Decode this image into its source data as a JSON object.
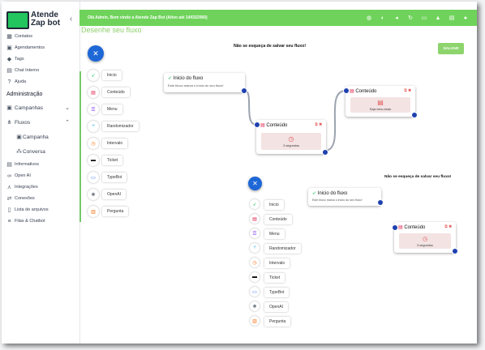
{
  "app": {
    "logo_line1": "Atende",
    "logo_line2": "Zap bot"
  },
  "topbar": {
    "message": "Olá Admin, Bem vindo a Atende Zap Bot (Ativo até 14/03/2060)"
  },
  "page": {
    "title": "Desenhe seu fluxo"
  },
  "sidebar": {
    "items": [
      {
        "label": "Contatos",
        "icon": "contacts-icon"
      },
      {
        "label": "Agendamentos",
        "icon": "calendar-icon"
      },
      {
        "label": "Tags",
        "icon": "tag-icon"
      },
      {
        "label": "Chat Interno",
        "icon": "chat-icon"
      },
      {
        "label": "Ajuda",
        "icon": "help-icon"
      }
    ],
    "section": "Administração",
    "groups": [
      {
        "label": "Campanhas",
        "icon": "campaign-icon"
      },
      {
        "label": "Fluxos",
        "icon": "flow-icon"
      }
    ],
    "sub_items": [
      {
        "label": "Campanha",
        "icon": "calendar-icon"
      },
      {
        "label": "Conversa",
        "icon": "conversation-icon"
      }
    ],
    "items2": [
      {
        "label": "Informativos",
        "icon": "info-icon"
      },
      {
        "label": "Open AI",
        "icon": "openai-icon"
      },
      {
        "label": "Integrações",
        "icon": "integration-icon"
      },
      {
        "label": "Conexões",
        "icon": "connection-icon"
      },
      {
        "label": "Lista de arquivos",
        "icon": "file-icon"
      },
      {
        "label": "Filas & Chatbot",
        "icon": "queue-icon"
      }
    ]
  },
  "canvas": {
    "notice": "Não se esqueça de salvar seu fluxo!",
    "save_label": "SALVAR",
    "palette": [
      "Inicio",
      "Conteúdo",
      "Menu",
      "Randomizador",
      "Intervalo",
      "Ticket",
      "TypeBot",
      "OpenAI",
      "Pergunta"
    ],
    "start_node": {
      "title": "Inicio do fluxo",
      "subtitle": "Este bloco marca o início do seu fluxo!"
    },
    "content_node_1": {
      "title": "Conteúdo",
      "text": "3 segundos"
    },
    "content_node_2": {
      "title": "Conteúdo",
      "text": "Seja bem-vindo"
    }
  },
  "canvas2": {
    "notice": "Não se esqueça de salvar seu fluxo!",
    "palette": [
      "Inicio",
      "Conteúdo",
      "Menu",
      "Randomizador",
      "Intervalo",
      "Ticket",
      "TypeBot",
      "OpenAI",
      "Pergunta"
    ],
    "start_node": {
      "title": "Inicio do fluxo",
      "subtitle": "Este bloco marca o início do seu fluxo!"
    },
    "content_node": {
      "title": "Conteúdo",
      "text": "3 segundos"
    }
  },
  "colors": {
    "accent": "#6fd35b",
    "fab": "#1e67d6",
    "port": "#1e40af"
  }
}
